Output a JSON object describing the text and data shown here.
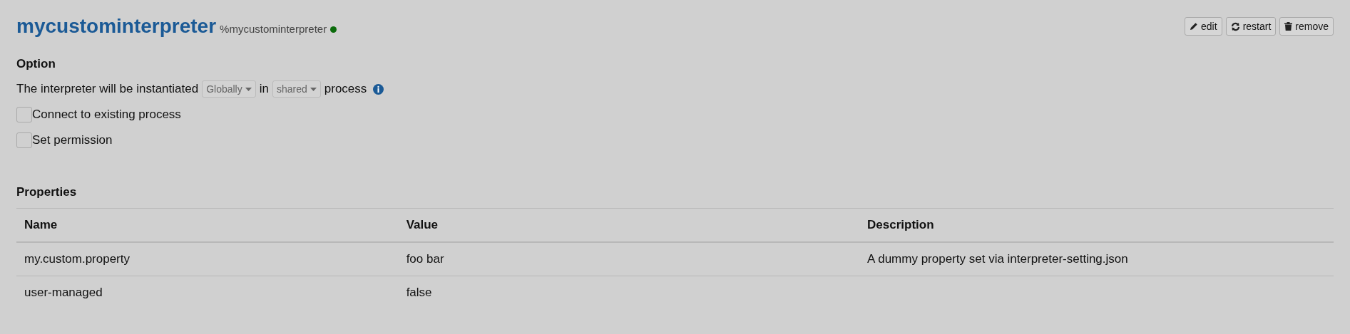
{
  "interpreter": {
    "name": "mycustominterpreter",
    "alias": "%mycustominterpreter",
    "running": true
  },
  "actions": [
    {
      "kind": "edit",
      "label": "edit"
    },
    {
      "kind": "restart",
      "label": "restart"
    },
    {
      "kind": "remove",
      "label": "remove"
    }
  ],
  "option": {
    "heading": "Option",
    "sentence": [
      {
        "kind": "text",
        "text": "The interpreter will be instantiated"
      },
      {
        "kind": "dropdown",
        "text": "Globally"
      },
      {
        "kind": "text",
        "text": "in"
      },
      {
        "kind": "dropdown",
        "text": "shared"
      },
      {
        "kind": "text",
        "text": "process"
      },
      {
        "kind": "info"
      }
    ],
    "checkboxes": [
      {
        "label": "Connect to existing process",
        "checked": false
      },
      {
        "label": "Set permission",
        "checked": false
      }
    ]
  },
  "properties": {
    "heading": "Properties",
    "columns": [
      "Name",
      "Value",
      "Description"
    ],
    "rows": [
      [
        "my.custom.property",
        "foo bar",
        "A dummy property set via interpreter-setting.json"
      ],
      [
        "user-managed",
        "false",
        ""
      ]
    ]
  }
}
